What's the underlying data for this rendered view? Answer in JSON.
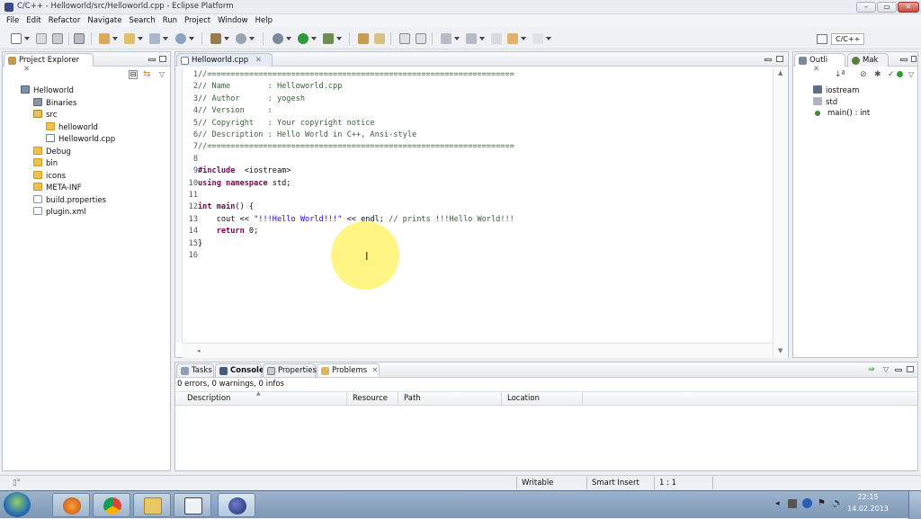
{
  "window": {
    "title": "C/C++ - Helloworld/src/Helloworld.cpp - Eclipse Platform",
    "min": "–",
    "max": "▭",
    "close": "✕"
  },
  "menu": [
    "File",
    "Edit",
    "Refactor",
    "Navigate",
    "Search",
    "Run",
    "Project",
    "Window",
    "Help"
  ],
  "perspective": {
    "label": "C/C++"
  },
  "project_explorer": {
    "tab": "Project Explorer",
    "tree": [
      {
        "label": "Helloworld",
        "indent": 0,
        "icon": "project-icon"
      },
      {
        "label": "Binaries",
        "indent": 1,
        "icon": "binaries-icon"
      },
      {
        "label": "src",
        "indent": 1,
        "icon": "source-folder-icon"
      },
      {
        "label": "helloworld",
        "indent": 2,
        "icon": "folder-icon"
      },
      {
        "label": "Helloworld.cpp",
        "indent": 2,
        "icon": "cpp-file-icon"
      },
      {
        "label": "Debug",
        "indent": 1,
        "icon": "folder-icon"
      },
      {
        "label": "bin",
        "indent": 1,
        "icon": "folder-icon"
      },
      {
        "label": "icons",
        "indent": 1,
        "icon": "folder-icon"
      },
      {
        "label": "META-INF",
        "indent": 1,
        "icon": "folder-icon"
      },
      {
        "label": "build.properties",
        "indent": 1,
        "icon": "file-icon"
      },
      {
        "label": "plugin.xml",
        "indent": 1,
        "icon": "file-icon"
      }
    ]
  },
  "editor": {
    "tab": "Helloworld.cpp",
    "lines": [
      {
        "n": "1",
        "parts": [
          [
            "cm",
            "//=================================================================="
          ]
        ]
      },
      {
        "n": "2",
        "parts": [
          [
            "cm",
            "// Name        : Helloworld.cpp"
          ]
        ]
      },
      {
        "n": "3",
        "parts": [
          [
            "cm",
            "// Author      : yogesh"
          ]
        ]
      },
      {
        "n": "4",
        "parts": [
          [
            "cm",
            "// Version     :"
          ]
        ]
      },
      {
        "n": "5",
        "parts": [
          [
            "cm",
            "// Copyright   : Your copyright notice"
          ]
        ]
      },
      {
        "n": "6",
        "parts": [
          [
            "cm",
            "// Description : Hello World in C++, Ansi-style"
          ]
        ]
      },
      {
        "n": "7",
        "parts": [
          [
            "cm",
            "//=================================================================="
          ]
        ]
      },
      {
        "n": "8",
        "parts": []
      },
      {
        "n": "9",
        "parts": [
          [
            "pp",
            "#include"
          ],
          [
            "",
            "  <iostream>"
          ]
        ]
      },
      {
        "n": "10",
        "parts": [
          [
            "kw",
            "using namespace"
          ],
          [
            "",
            " std;"
          ]
        ]
      },
      {
        "n": "11",
        "parts": []
      },
      {
        "n": "12",
        "parts": [
          [
            "kw",
            "int"
          ],
          [
            "",
            " "
          ],
          [
            "kw",
            "main"
          ],
          [
            "",
            "() {"
          ]
        ]
      },
      {
        "n": "13",
        "parts": [
          [
            "",
            "    cout << "
          ],
          [
            "str",
            "\"!!!Hello World!!!\""
          ],
          [
            "",
            " << endl; "
          ],
          [
            "cm",
            "// prints !!!Hello World!!!"
          ]
        ]
      },
      {
        "n": "14",
        "parts": [
          [
            "",
            "    "
          ],
          [
            "kw",
            "return"
          ],
          [
            "",
            " 0;"
          ]
        ]
      },
      {
        "n": "15",
        "parts": [
          [
            "",
            "}"
          ]
        ]
      },
      {
        "n": "16",
        "parts": []
      }
    ]
  },
  "outline": {
    "tabs": [
      "Outli",
      "Mak"
    ],
    "items": [
      {
        "label": "iostream",
        "icon": "include-icon"
      },
      {
        "label": "std",
        "icon": "namespace-icon"
      },
      {
        "label": "main() : int",
        "icon": "function-icon"
      }
    ]
  },
  "bottom": {
    "tabs": [
      "Tasks",
      "Console",
      "Properties",
      "Problems"
    ],
    "summary": "0 errors, 0 warnings, 0 infos",
    "columns": [
      "Description",
      "Resource",
      "Path",
      "Location"
    ]
  },
  "status": {
    "mode": "Writable",
    "insert": "Smart Insert",
    "position": "1 : 1"
  },
  "taskbar": {
    "time": "22:15",
    "date": "14.02.2013"
  }
}
